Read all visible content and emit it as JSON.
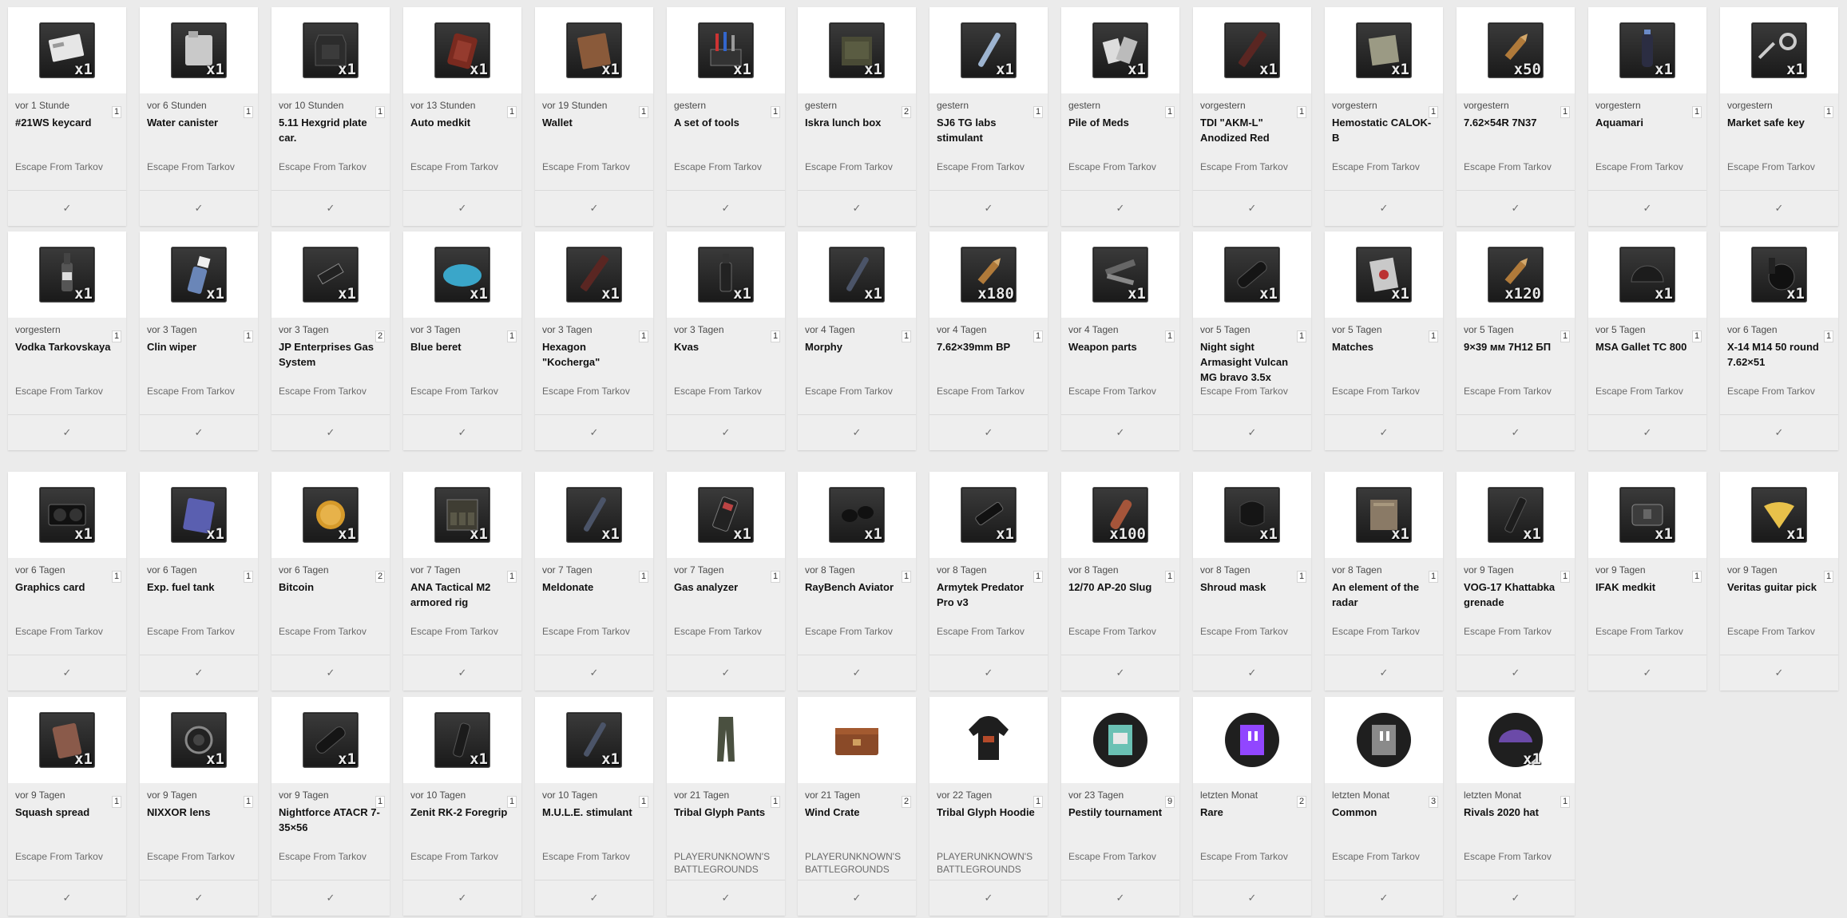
{
  "check_symbol": "✓",
  "rows": [
    [
      {
        "time": "vor 1 Stunde",
        "count": "1",
        "name": "#21WS keycard",
        "game": "Escape From Tarkov",
        "qty": "x1",
        "icon": "keycard-icon"
      },
      {
        "time": "vor 6 Stunden",
        "count": "1",
        "name": "Water canister",
        "game": "Escape From Tarkov",
        "qty": "x1",
        "icon": "water-canister-icon"
      },
      {
        "time": "vor 10 Stunden",
        "count": "1",
        "name": "5.11 Hexgrid plate car.",
        "game": "Escape From Tarkov",
        "qty": "x1",
        "icon": "plate-carrier-icon"
      },
      {
        "time": "vor 13 Stunden",
        "count": "1",
        "name": "Auto medkit",
        "game": "Escape From Tarkov",
        "qty": "x1",
        "icon": "medkit-icon"
      },
      {
        "time": "vor 19 Stunden",
        "count": "1",
        "name": "Wallet",
        "game": "Escape From Tarkov",
        "qty": "x1",
        "icon": "wallet-icon"
      },
      {
        "time": "gestern",
        "count": "1",
        "name": "A set of tools",
        "game": "Escape From Tarkov",
        "qty": "x1",
        "icon": "tools-icon"
      },
      {
        "time": "gestern",
        "count": "2",
        "name": "Iskra lunch box",
        "game": "Escape From Tarkov",
        "qty": "x1",
        "icon": "lunch-box-icon"
      },
      {
        "time": "gestern",
        "count": "1",
        "name": "SJ6 TG labs stimulant",
        "game": "Escape From Tarkov",
        "qty": "x1",
        "icon": "stimulant-icon"
      },
      {
        "time": "gestern",
        "count": "1",
        "name": "Pile of Meds",
        "game": "Escape From Tarkov",
        "qty": "x1",
        "icon": "meds-icon"
      },
      {
        "time": "vorgestern",
        "count": "1",
        "name": "TDI \"AKM-L\" Anodized Red",
        "game": "Escape From Tarkov",
        "qty": "x1",
        "icon": "handguard-icon"
      },
      {
        "time": "vorgestern",
        "count": "1",
        "name": "Hemostatic CALOK-B",
        "game": "Escape From Tarkov",
        "qty": "x1",
        "icon": "hemostatic-icon"
      },
      {
        "time": "vorgestern",
        "count": "1",
        "name": "7.62×54R 7N37",
        "game": "Escape From Tarkov",
        "qty": "x50",
        "icon": "ammo-icon"
      },
      {
        "time": "vorgestern",
        "count": "1",
        "name": "Aquamari",
        "game": "Escape From Tarkov",
        "qty": "x1",
        "icon": "water-bottle-icon"
      },
      {
        "time": "vorgestern",
        "count": "1",
        "name": "Market safe key",
        "game": "Escape From Tarkov",
        "qty": "x1",
        "icon": "key-icon"
      }
    ],
    [
      {
        "time": "vorgestern",
        "count": "1",
        "name": "Vodka Tarkovskaya",
        "game": "Escape From Tarkov",
        "qty": "x1",
        "icon": "vodka-bottle-icon"
      },
      {
        "time": "vor 3 Tagen",
        "count": "1",
        "name": "Clin wiper",
        "game": "Escape From Tarkov",
        "qty": "x1",
        "icon": "spray-bottle-icon"
      },
      {
        "time": "vor 3 Tagen",
        "count": "2",
        "name": "JP Enterprises Gas System",
        "game": "Escape From Tarkov",
        "qty": "x1",
        "icon": "gas-system-icon"
      },
      {
        "time": "vor 3 Tagen",
        "count": "1",
        "name": "Blue beret",
        "game": "Escape From Tarkov",
        "qty": "x1",
        "icon": "beret-icon"
      },
      {
        "time": "vor 3 Tagen",
        "count": "1",
        "name": "Hexagon \"Kocherga\"",
        "game": "Escape From Tarkov",
        "qty": "x1",
        "icon": "handguard-icon"
      },
      {
        "time": "vor 3 Tagen",
        "count": "1",
        "name": "Kvas",
        "game": "Escape From Tarkov",
        "qty": "x1",
        "icon": "bottle-icon"
      },
      {
        "time": "vor 4 Tagen",
        "count": "1",
        "name": "Morphy",
        "game": "Escape From Tarkov",
        "qty": "x1",
        "icon": "syringe-icon"
      },
      {
        "time": "vor 4 Tagen",
        "count": "1",
        "name": "7.62×39mm BP",
        "game": "Escape From Tarkov",
        "qty": "x180",
        "icon": "ammo-icon"
      },
      {
        "time": "vor 4 Tagen",
        "count": "1",
        "name": "Weapon parts",
        "game": "Escape From Tarkov",
        "qty": "x1",
        "icon": "weapon-parts-icon"
      },
      {
        "time": "vor 5 Tagen",
        "count": "1",
        "name": "Night sight Armasight Vulcan MG bravo 3.5x",
        "game": "Escape From Tarkov",
        "qty": "x1",
        "icon": "scope-icon"
      },
      {
        "time": "vor 5 Tagen",
        "count": "1",
        "name": "Matches",
        "game": "Escape From Tarkov",
        "qty": "x1",
        "icon": "matches-icon"
      },
      {
        "time": "vor 5 Tagen",
        "count": "1",
        "name": "9×39 мм 7Н12 БП",
        "game": "Escape From Tarkov",
        "qty": "x120",
        "icon": "ammo-icon"
      },
      {
        "time": "vor 5 Tagen",
        "count": "1",
        "name": "MSA Gallet TC 800",
        "game": "Escape From Tarkov",
        "qty": "x1",
        "icon": "helmet-icon"
      },
      {
        "time": "vor 6 Tagen",
        "count": "1",
        "name": "X-14 M14 50 round 7.62×51",
        "game": "Escape From Tarkov",
        "qty": "x1",
        "icon": "drum-magazine-icon"
      }
    ],
    [
      {
        "time": "vor 6 Tagen",
        "count": "1",
        "name": "Graphics card",
        "game": "Escape From Tarkov",
        "qty": "x1",
        "icon": "graphics-card-icon"
      },
      {
        "time": "vor 6 Tagen",
        "count": "1",
        "name": "Exp. fuel tank",
        "game": "Escape From Tarkov",
        "qty": "x1",
        "icon": "fuel-tank-icon"
      },
      {
        "time": "vor 6 Tagen",
        "count": "2",
        "name": "Bitcoin",
        "game": "Escape From Tarkov",
        "qty": "x1",
        "icon": "bitcoin-icon"
      },
      {
        "time": "vor 7 Tagen",
        "count": "1",
        "name": "ANA Tactical M2 armored rig",
        "game": "Escape From Tarkov",
        "qty": "x1",
        "icon": "armored-rig-icon"
      },
      {
        "time": "vor 7 Tagen",
        "count": "1",
        "name": "Meldonate",
        "game": "Escape From Tarkov",
        "qty": "x1",
        "icon": "syringe-icon"
      },
      {
        "time": "vor 7 Tagen",
        "count": "1",
        "name": "Gas analyzer",
        "game": "Escape From Tarkov",
        "qty": "x1",
        "icon": "gas-analyzer-icon"
      },
      {
        "time": "vor 8 Tagen",
        "count": "1",
        "name": "RayBench Aviator",
        "game": "Escape From Tarkov",
        "qty": "x1",
        "icon": "sunglasses-icon"
      },
      {
        "time": "vor 8 Tagen",
        "count": "1",
        "name": "Armytek Predator Pro v3",
        "game": "Escape From Tarkov",
        "qty": "x1",
        "icon": "flashlight-icon"
      },
      {
        "time": "vor 8 Tagen",
        "count": "1",
        "name": "12/70 AP-20 Slug",
        "game": "Escape From Tarkov",
        "qty": "x100",
        "icon": "shell-icon"
      },
      {
        "time": "vor 8 Tagen",
        "count": "1",
        "name": "Shroud mask",
        "game": "Escape From Tarkov",
        "qty": "x1",
        "icon": "mask-icon"
      },
      {
        "time": "vor 8 Tagen",
        "count": "1",
        "name": "An element of the radar",
        "game": "Escape From Tarkov",
        "qty": "x1",
        "icon": "radar-element-icon"
      },
      {
        "time": "vor 9 Tagen",
        "count": "1",
        "name": "VOG-17 Khattabka grenade",
        "game": "Escape From Tarkov",
        "qty": "x1",
        "icon": "grenade-icon"
      },
      {
        "time": "vor 9 Tagen",
        "count": "1",
        "name": "IFAK medkit",
        "game": "Escape From Tarkov",
        "qty": "x1",
        "icon": "ifak-icon"
      },
      {
        "time": "vor 9 Tagen",
        "count": "1",
        "name": "Veritas guitar pick",
        "game": "Escape From Tarkov",
        "qty": "x1",
        "icon": "guitar-pick-icon"
      }
    ],
    [
      {
        "time": "vor 9 Tagen",
        "count": "1",
        "name": "Squash spread",
        "game": "Escape From Tarkov",
        "qty": "x1",
        "icon": "can-icon"
      },
      {
        "time": "vor 9 Tagen",
        "count": "1",
        "name": "NIXXOR lens",
        "game": "Escape From Tarkov",
        "qty": "x1",
        "icon": "lens-icon"
      },
      {
        "time": "vor 9 Tagen",
        "count": "1",
        "name": "Nightforce ATACR 7-35×56",
        "game": "Escape From Tarkov",
        "qty": "x1",
        "icon": "scope-icon"
      },
      {
        "time": "vor 10 Tagen",
        "count": "1",
        "name": "Zenit RK-2 Foregrip",
        "game": "Escape From Tarkov",
        "qty": "x1",
        "icon": "foregrip-icon"
      },
      {
        "time": "vor 10 Tagen",
        "count": "1",
        "name": "M.U.L.E. stimulant",
        "game": "Escape From Tarkov",
        "qty": "x1",
        "icon": "syringe-icon"
      },
      {
        "time": "vor 21 Tagen",
        "count": "1",
        "name": "Tribal Glyph Pants",
        "game": "PLAYERUNKNOWN'S BATTLEGROUNDS",
        "qty": "",
        "icon": "pants-icon"
      },
      {
        "time": "vor 21 Tagen",
        "count": "2",
        "name": "Wind Crate",
        "game": "PLAYERUNKNOWN'S BATTLEGROUNDS",
        "qty": "",
        "icon": "crate-icon"
      },
      {
        "time": "vor 22 Tagen",
        "count": "1",
        "name": "Tribal Glyph Hoodie",
        "game": "PLAYERUNKNOWN'S BATTLEGROUNDS",
        "qty": "",
        "icon": "hoodie-icon"
      },
      {
        "time": "vor 23 Tagen",
        "count": "9",
        "name": "Pestily tournament",
        "game": "Escape From Tarkov",
        "qty": "",
        "icon": "twitch-drop-teal-icon"
      },
      {
        "time": "letzten Monat",
        "count": "2",
        "name": "Rare",
        "game": "Escape From Tarkov",
        "qty": "",
        "icon": "twitch-drop-purple-icon"
      },
      {
        "time": "letzten Monat",
        "count": "3",
        "name": "Common",
        "game": "Escape From Tarkov",
        "qty": "",
        "icon": "twitch-drop-gray-icon"
      },
      {
        "time": "letzten Monat",
        "count": "1",
        "name": "Rivals 2020 hat",
        "game": "Escape From Tarkov",
        "qty": "x1",
        "icon": "rivals-hat-icon"
      }
    ]
  ]
}
